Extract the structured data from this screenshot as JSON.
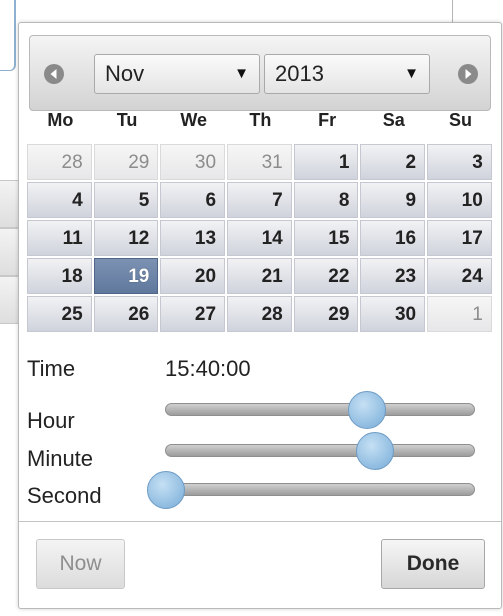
{
  "datepicker": {
    "month_select": {
      "value": "Nov",
      "arrow": "▼"
    },
    "year_select": {
      "value": "2013",
      "arrow": "▼"
    },
    "prev_icon": "circle-triangle-left-icon",
    "next_icon": "circle-triangle-right-icon",
    "weekdays": [
      "Mo",
      "Tu",
      "We",
      "Th",
      "Fr",
      "Sa",
      "Su"
    ],
    "weeks": [
      [
        {
          "d": "28",
          "other": true
        },
        {
          "d": "29",
          "other": true
        },
        {
          "d": "30",
          "other": true
        },
        {
          "d": "31",
          "other": true
        },
        {
          "d": "1"
        },
        {
          "d": "2"
        },
        {
          "d": "3"
        }
      ],
      [
        {
          "d": "4"
        },
        {
          "d": "5"
        },
        {
          "d": "6"
        },
        {
          "d": "7"
        },
        {
          "d": "8"
        },
        {
          "d": "9"
        },
        {
          "d": "10"
        }
      ],
      [
        {
          "d": "11"
        },
        {
          "d": "12"
        },
        {
          "d": "13"
        },
        {
          "d": "14"
        },
        {
          "d": "15"
        },
        {
          "d": "16"
        },
        {
          "d": "17"
        }
      ],
      [
        {
          "d": "18"
        },
        {
          "d": "19",
          "selected": true
        },
        {
          "d": "20"
        },
        {
          "d": "21"
        },
        {
          "d": "22"
        },
        {
          "d": "23"
        },
        {
          "d": "24"
        }
      ],
      [
        {
          "d": "25"
        },
        {
          "d": "26"
        },
        {
          "d": "27"
        },
        {
          "d": "28"
        },
        {
          "d": "29"
        },
        {
          "d": "30"
        },
        {
          "d": "1",
          "other": true
        }
      ]
    ]
  },
  "time": {
    "label": "Time",
    "value": "15:40:00",
    "sliders": [
      {
        "key": "hour",
        "label": "Hour",
        "value": 15,
        "max": 23
      },
      {
        "key": "minute",
        "label": "Minute",
        "value": 40,
        "max": 59
      },
      {
        "key": "second",
        "label": "Second",
        "value": 0,
        "max": 59
      }
    ]
  },
  "buttons": {
    "now": "Now",
    "done": "Done"
  },
  "colors": {
    "selected_day": "#6b82a6",
    "slider_handle": "#9cc5e6"
  }
}
